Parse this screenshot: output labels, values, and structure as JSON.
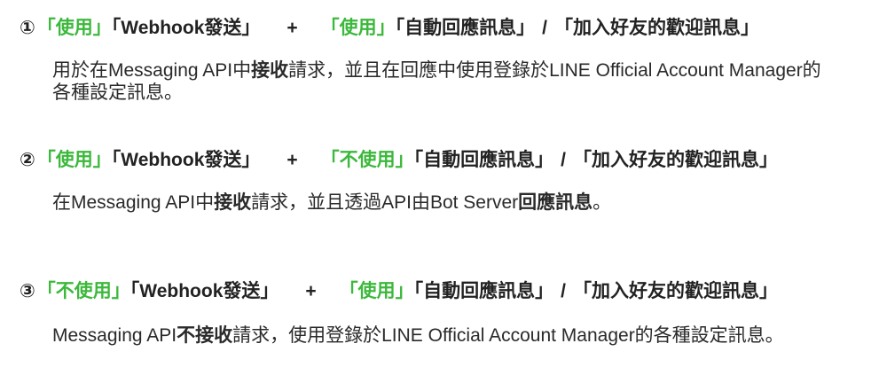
{
  "options": [
    {
      "number": "①",
      "webhook_state": "「使用」",
      "webhook_label": "「Webhook發送」",
      "plus": "+",
      "auto_reply_state": "「使用」",
      "auto_reply_label": "「自動回應訊息」",
      "slash": "/",
      "welcome_label": "「加入好友的歡迎訊息」",
      "desc_1": "用於在Messaging API中",
      "desc_bold_1": "接收",
      "desc_2": "請求，並且在回應中使用登錄於LINE Official Account Manager的各種設定訊息。"
    },
    {
      "number": "②",
      "webhook_state": "「使用」",
      "webhook_label": "「Webhook發送」",
      "plus": "+",
      "auto_reply_state": "「不使用」",
      "auto_reply_label": "「自動回應訊息」",
      "slash": "/",
      "welcome_label": "「加入好友的歡迎訊息」",
      "desc_1": "在Messaging API中",
      "desc_bold_1": "接收",
      "desc_2": "請求，並且透過API由Bot Server",
      "desc_bold_2": "回應訊息",
      "desc_3": "。"
    },
    {
      "number": "③",
      "webhook_state": "「不使用」",
      "webhook_label": "「Webhook發送」",
      "plus": "+",
      "auto_reply_state": "「使用」",
      "auto_reply_label": "「自動回應訊息」",
      "slash": "/",
      "welcome_label": "「加入好友的歡迎訊息」",
      "desc_1": "Messaging API",
      "desc_bold_1": "不接收",
      "desc_2": "請求，使用登錄於LINE Official Account Manager的各種設定訊息。"
    }
  ]
}
